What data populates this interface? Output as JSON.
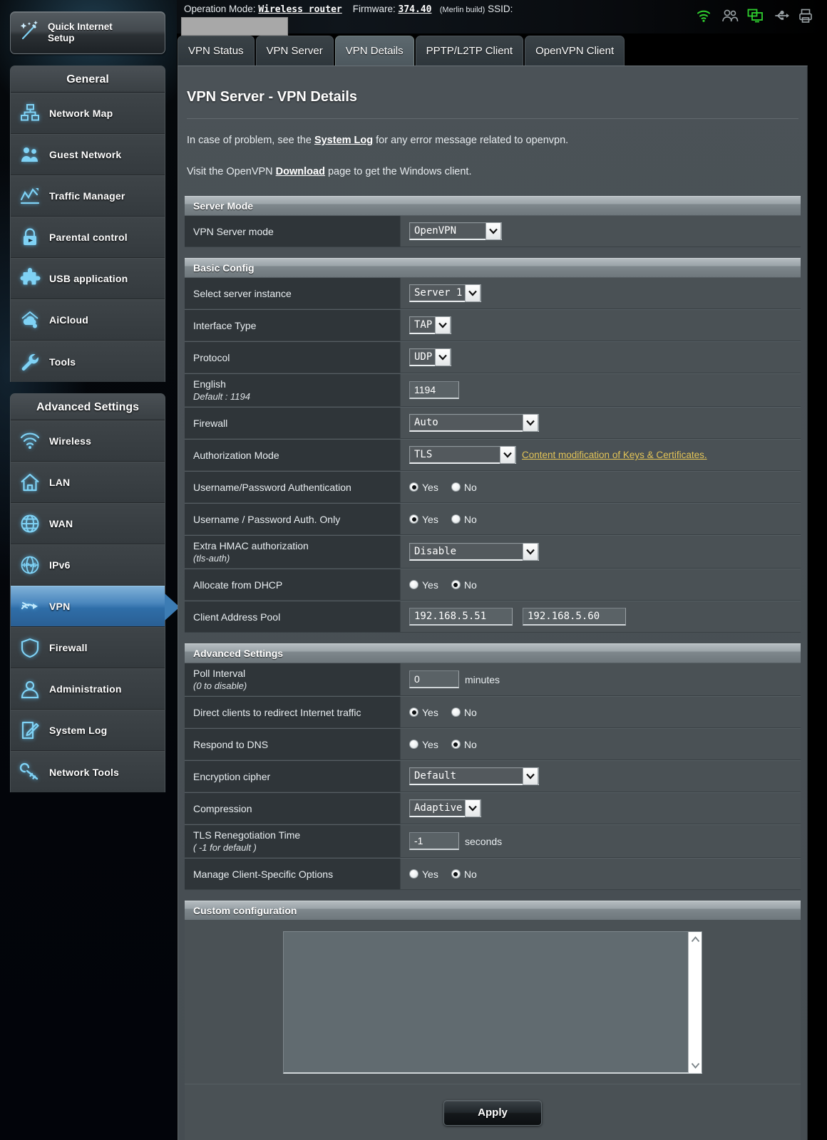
{
  "topbar": {
    "operation_mode_label": "Operation Mode:",
    "operation_mode_value": "Wireless router",
    "firmware_label": "Firmware:",
    "firmware_value": "374.40",
    "build_note": "(Merlin build)",
    "ssid_label": "SSID:",
    "ssid_value": "",
    "icons": [
      {
        "name": "wifi-icon",
        "color": "#2fd02f"
      },
      {
        "name": "users-icon",
        "color": "#9aa2a6"
      },
      {
        "name": "monitor-icon",
        "color": "#2fd02f"
      },
      {
        "name": "usb-icon",
        "color": "#9aa2a6"
      },
      {
        "name": "printer-icon",
        "color": "#9aa2a6"
      }
    ]
  },
  "sidebar": {
    "quick_setup": "Quick Internet Setup",
    "general_header": "General",
    "general_items": [
      {
        "label": "Network Map",
        "icon": "network-map-icon"
      },
      {
        "label": "Guest Network",
        "icon": "guest-network-icon"
      },
      {
        "label": "Traffic Manager",
        "icon": "traffic-manager-icon"
      },
      {
        "label": "Parental control",
        "icon": "parental-control-icon"
      },
      {
        "label": "USB application",
        "icon": "usb-application-icon"
      },
      {
        "label": "AiCloud",
        "icon": "aicloud-icon"
      },
      {
        "label": "Tools",
        "icon": "tools-icon"
      }
    ],
    "advanced_header": "Advanced Settings",
    "advanced_items": [
      {
        "label": "Wireless",
        "icon": "wireless-icon",
        "active": false
      },
      {
        "label": "LAN",
        "icon": "lan-icon",
        "active": false
      },
      {
        "label": "WAN",
        "icon": "wan-icon",
        "active": false
      },
      {
        "label": "IPv6",
        "icon": "ipv6-icon",
        "active": false
      },
      {
        "label": "VPN",
        "icon": "vpn-icon",
        "active": true
      },
      {
        "label": "Firewall",
        "icon": "firewall-icon",
        "active": false
      },
      {
        "label": "Administration",
        "icon": "administration-icon",
        "active": false
      },
      {
        "label": "System Log",
        "icon": "system-log-icon",
        "active": false
      },
      {
        "label": "Network Tools",
        "icon": "network-tools-icon",
        "active": false
      }
    ]
  },
  "tabs": [
    {
      "label": "VPN Status",
      "active": false
    },
    {
      "label": "VPN Server",
      "active": false
    },
    {
      "label": "VPN Details",
      "active": true
    },
    {
      "label": "PPTP/L2TP Client",
      "active": false
    },
    {
      "label": "OpenVPN Client",
      "active": false
    }
  ],
  "page": {
    "title": "VPN Server - VPN Details",
    "desc1_pre": "In case of problem, see the ",
    "desc1_link": "System Log",
    "desc1_post": " for any error message related to openvpn.",
    "desc2_pre": "Visit the OpenVPN ",
    "desc2_link": "Download",
    "desc2_post": " page to get the Windows client."
  },
  "server_mode": {
    "header": "Server Mode",
    "vpn_server_mode_label": "VPN Server mode",
    "vpn_server_mode_value": "OpenVPN"
  },
  "basic_config": {
    "header": "Basic Config",
    "select_server_instance_label": "Select server instance",
    "select_server_instance_value": "Server 1",
    "interface_type_label": "Interface Type",
    "interface_type_value": "TAP",
    "protocol_label": "Protocol",
    "protocol_value": "UDP",
    "port_label": "English",
    "port_sub": "Default : 1194",
    "port_value": "1194",
    "firewall_label": "Firewall",
    "firewall_value": "Auto",
    "auth_mode_label": "Authorization Mode",
    "auth_mode_value": "TLS",
    "auth_mode_link": "Content modification of Keys & Certificates.",
    "userpass_auth_label": "Username/Password Authentication",
    "userpass_auth_value": "Yes",
    "userpass_only_label": "Username / Password Auth. Only",
    "userpass_only_value": "Yes",
    "hmac_label": "Extra HMAC authorization",
    "hmac_sub": "(tls-auth)",
    "hmac_value": "Disable",
    "dhcp_label": "Allocate from DHCP",
    "dhcp_value": "No",
    "pool_label": "Client Address Pool",
    "pool_start": "192.168.5.51",
    "pool_end": "192.168.5.60",
    "yes_label": "Yes",
    "no_label": "No"
  },
  "advanced": {
    "header": "Advanced Settings",
    "poll_label": "Poll Interval",
    "poll_sub": "(0 to disable)",
    "poll_value": "0",
    "poll_unit": "minutes",
    "redirect_label": "Direct clients to redirect Internet traffic",
    "redirect_value": "Yes",
    "dns_label": "Respond to DNS",
    "dns_value": "No",
    "cipher_label": "Encryption cipher",
    "cipher_value": "Default",
    "compression_label": "Compression",
    "compression_value": "Adaptive",
    "tls_reneg_label": "TLS Renegotiation Time",
    "tls_reneg_sub": "( -1 for default )",
    "tls_reneg_value": "-1",
    "tls_reneg_unit": "seconds",
    "client_opts_label": "Manage Client-Specific Options",
    "client_opts_value": "No",
    "yes_label": "Yes",
    "no_label": "No"
  },
  "custom_config": {
    "header": "Custom configuration",
    "textarea_value": ""
  },
  "footer": {
    "apply_label": "Apply"
  },
  "colors": {
    "accent_blue": "#4a86bd",
    "link_yellow": "#e3c457",
    "icon_green": "#2fd02f",
    "panel_bg": "#4a5155",
    "label_bg": "#2f3539"
  }
}
